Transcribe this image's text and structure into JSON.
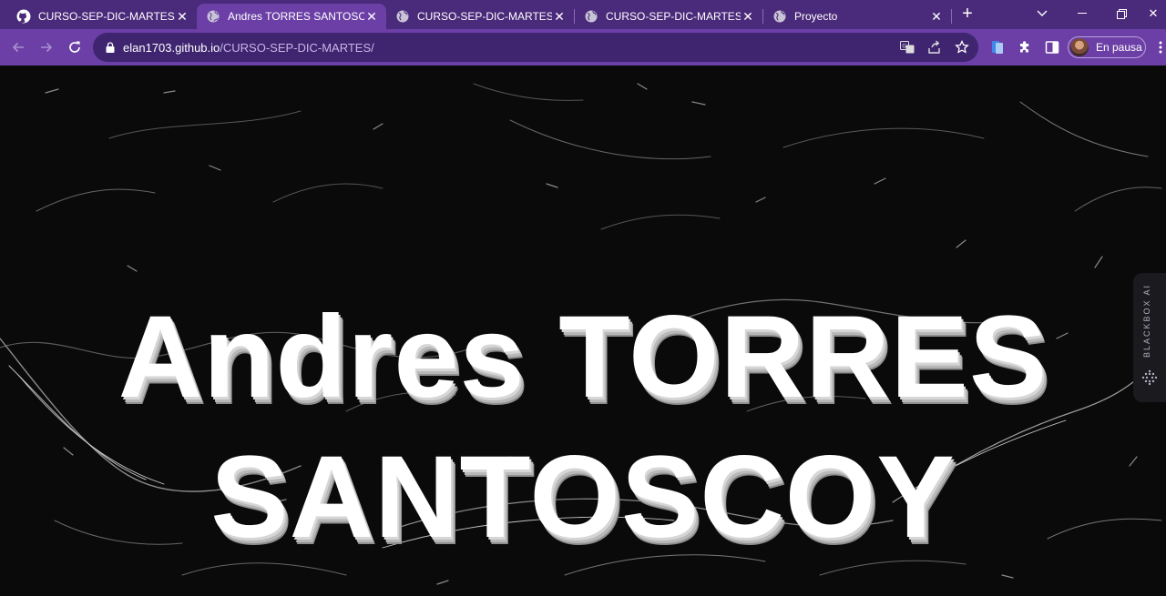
{
  "browser": {
    "tabs": [
      {
        "title": "CURSO-SEP-DIC-MARTES/in",
        "icon": "github-icon",
        "active": false
      },
      {
        "title": "Andres TORRES SANTOSCO",
        "icon": "globe-icon",
        "active": true
      },
      {
        "title": "CURSO-SEP-DIC-MARTES | A",
        "icon": "globe-icon",
        "active": false
      },
      {
        "title": "CURSO-SEP-DIC-MARTES | A",
        "icon": "globe-icon",
        "active": false
      },
      {
        "title": "Proyecto",
        "icon": "globe-icon",
        "active": false
      }
    ],
    "url_host": "elan1703.github.io",
    "url_path": "/CURSO-SEP-DIC-MARTES/",
    "profile_status": "En pausa",
    "colors": {
      "tabbar": "#4a2a7a",
      "toolbar": "#6b3fa6",
      "omnibox": "#3f2470"
    }
  },
  "page": {
    "heading": "Andres TORRES SANTOSCOY",
    "background": "#0a0a0a"
  },
  "blackbox": {
    "label": "BLACKBOX AI"
  }
}
